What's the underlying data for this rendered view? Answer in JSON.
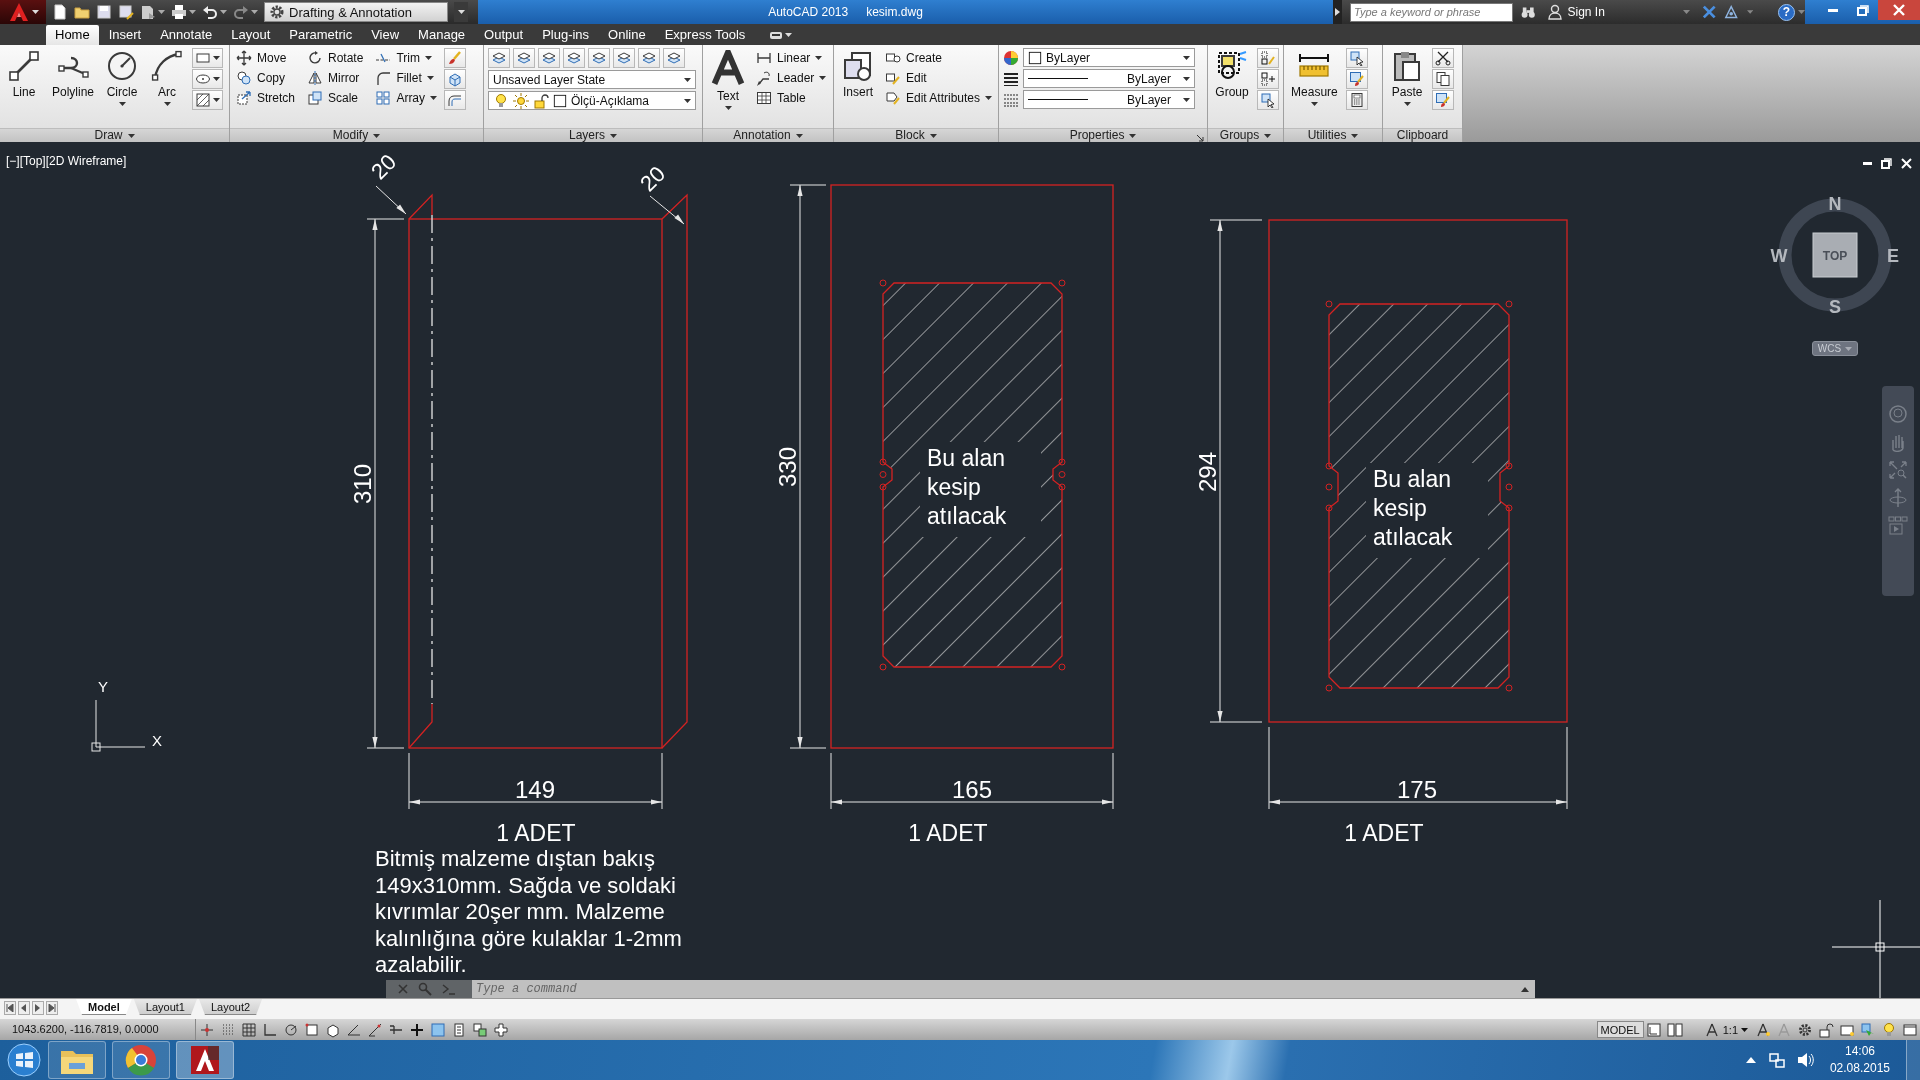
{
  "title_bar": {
    "workspace": "Drafting & Annotation",
    "app_title": "AutoCAD 2013",
    "file_name": "kesim.dwg",
    "search_placeholder": "Type a keyword or phrase",
    "sign_in": "Sign In",
    "help": "?"
  },
  "ribbon_tabs": [
    {
      "label": "Home",
      "selected": true
    },
    {
      "label": "Insert",
      "selected": false
    },
    {
      "label": "Annotate",
      "selected": false
    },
    {
      "label": "Layout",
      "selected": false
    },
    {
      "label": "Parametric",
      "selected": false
    },
    {
      "label": "View",
      "selected": false
    },
    {
      "label": "Manage",
      "selected": false
    },
    {
      "label": "Output",
      "selected": false
    },
    {
      "label": "Plug-ins",
      "selected": false
    },
    {
      "label": "Online",
      "selected": false
    },
    {
      "label": "Express Tools",
      "selected": false
    }
  ],
  "ribbon_panels": [
    {
      "title": "Draw",
      "dropdown": true,
      "launcher": false,
      "tools": [
        {
          "label": "Line",
          "kind": "large",
          "dropdown": false
        },
        {
          "label": "Polyline",
          "kind": "large",
          "dropdown": false
        },
        {
          "label": "Circle",
          "kind": "large",
          "dropdown": true
        },
        {
          "label": "Arc",
          "kind": "large",
          "dropdown": true
        }
      ]
    },
    {
      "title": "Modify",
      "dropdown": true,
      "launcher": false,
      "tools": [
        {
          "label": "Move",
          "kind": "small",
          "dropdown": false
        },
        {
          "label": "Copy",
          "kind": "small",
          "dropdown": false
        },
        {
          "label": "Stretch",
          "kind": "small",
          "dropdown": false
        },
        {
          "label": "Rotate",
          "kind": "small",
          "dropdown": false
        },
        {
          "label": "Mirror",
          "kind": "small",
          "dropdown": false
        },
        {
          "label": "Scale",
          "kind": "small",
          "dropdown": false
        },
        {
          "label": "Trim",
          "kind": "small",
          "dropdown": true
        },
        {
          "label": "Fillet",
          "kind": "small",
          "dropdown": true
        },
        {
          "label": "Array",
          "kind": "small",
          "dropdown": true
        }
      ]
    },
    {
      "title": "Layers",
      "dropdown": true,
      "launcher": false,
      "tools": [
        {
          "kind": "combo",
          "value": "Unsaved Layer State"
        },
        {
          "kind": "combo",
          "value": "Ölçü-Açıklama"
        }
      ]
    },
    {
      "title": "Annotation",
      "dropdown": true,
      "launcher": false,
      "tools": [
        {
          "label": "Text",
          "kind": "large",
          "dropdown": true
        },
        {
          "label": "Linear",
          "kind": "small",
          "dropdown": true
        },
        {
          "label": "Leader",
          "kind": "small",
          "dropdown": true
        },
        {
          "label": "Table",
          "kind": "small",
          "dropdown": false
        }
      ]
    },
    {
      "title": "Block",
      "dropdown": true,
      "launcher": false,
      "tools": [
        {
          "label": "Insert",
          "kind": "large",
          "dropdown": false
        },
        {
          "label": "Create",
          "kind": "small",
          "dropdown": false
        },
        {
          "label": "Edit",
          "kind": "small",
          "dropdown": false
        },
        {
          "label": "Edit Attributes",
          "kind": "small",
          "dropdown": true
        }
      ]
    },
    {
      "title": "Properties",
      "dropdown": true,
      "launcher": true,
      "tools": [
        {
          "kind": "combo",
          "value": "ByLayer"
        },
        {
          "kind": "combo",
          "value": "ByLayer"
        },
        {
          "kind": "combo",
          "value": "ByLayer"
        }
      ]
    },
    {
      "title": "Groups",
      "dropdown": true,
      "launcher": false,
      "tools": [
        {
          "label": "Group",
          "kind": "large",
          "dropdown": false
        }
      ]
    },
    {
      "title": "Utilities",
      "dropdown": true,
      "launcher": false,
      "tools": [
        {
          "label": "Measure",
          "kind": "large",
          "dropdown": true
        }
      ]
    },
    {
      "title": "Clipboard",
      "dropdown": false,
      "launcher": false,
      "tools": [
        {
          "label": "Paste",
          "kind": "large",
          "dropdown": true
        }
      ]
    }
  ],
  "viewport": {
    "label": "[−][Top][2D Wireframe]",
    "viewcube": {
      "north": "N",
      "east": "E",
      "south": "S",
      "west": "W",
      "face": "TOP",
      "coordinate_system": "WCS"
    },
    "ucs": {
      "x": "X",
      "y": "Y"
    }
  },
  "drawing": {
    "parts": [
      {
        "height_dim": "310",
        "width_dim": "149",
        "flange_dims": [
          "20",
          "20"
        ],
        "quantity": "1 ADET"
      },
      {
        "height_dim": "330",
        "width_dim": "165",
        "quantity": "1 ADET",
        "cutout_label": [
          "Bu alan",
          "kesip",
          "atılacak"
        ]
      },
      {
        "height_dim": "294",
        "width_dim": "175",
        "quantity": "1 ADET",
        "cutout_label": [
          "Bu alan",
          "kesip",
          "atılacak"
        ]
      }
    ],
    "note": [
      "Bitmiş malzeme dıştan bakış",
      "149x310mm. Sağda ve soldaki",
      "kıvrımlar 20şer mm. Malzeme",
      "kalınlığına göre kulaklar 1-2mm",
      "azalabilir."
    ]
  },
  "command_line": {
    "placeholder": "Type a command"
  },
  "layout_tabs": [
    {
      "label": "Model",
      "selected": true
    },
    {
      "label": "Layout1",
      "selected": false
    },
    {
      "label": "Layout2",
      "selected": false
    }
  ],
  "status_bar": {
    "coordinates": "1043.6200, -116.7819, 0.0000",
    "space": "MODEL",
    "annotation_scale": "1:1"
  },
  "taskbar": {
    "time": "14:06",
    "date": "02.08.2015"
  }
}
